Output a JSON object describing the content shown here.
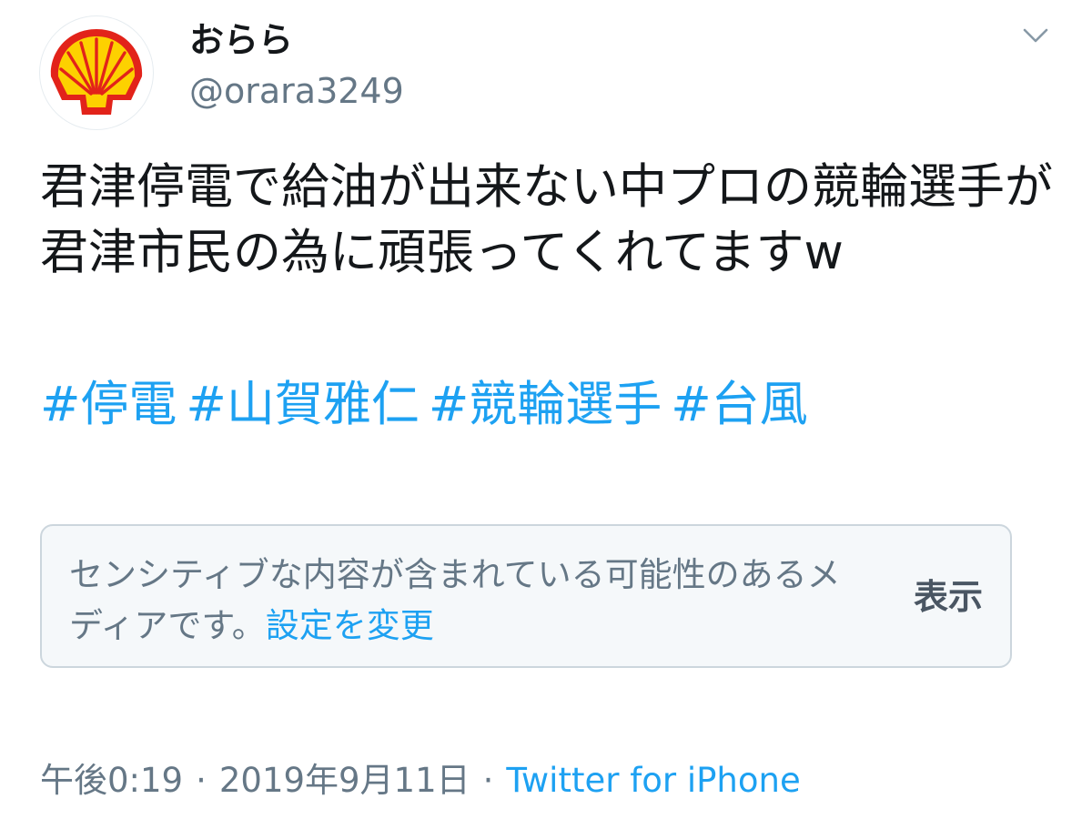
{
  "user": {
    "display_name": "おらら",
    "handle": "@orara3249",
    "avatar_icon": "shell-logo-icon"
  },
  "menu": {
    "icon": "chevron-down-icon"
  },
  "tweet": {
    "text": "君津停電で給油が出来ない中プロの競輪選手が君津市民の為に頑張ってくれてますw",
    "hashtags": [
      "#停電",
      "#山賀雅仁",
      "#競輪選手",
      "#台風"
    ]
  },
  "sensitive_media": {
    "warning_text": "センシティブな内容が含まれている可能性のあるメディアです。",
    "settings_link": "設定を変更",
    "show_label": "表示"
  },
  "meta": {
    "time": "午後0:19",
    "separator": "·",
    "date": "2019年9月11日",
    "source": "Twitter for iPhone"
  },
  "colors": {
    "link": "#1da1f2",
    "secondary_text": "#657786",
    "shell_yellow": "#fdd100",
    "shell_red": "#e2231a"
  }
}
